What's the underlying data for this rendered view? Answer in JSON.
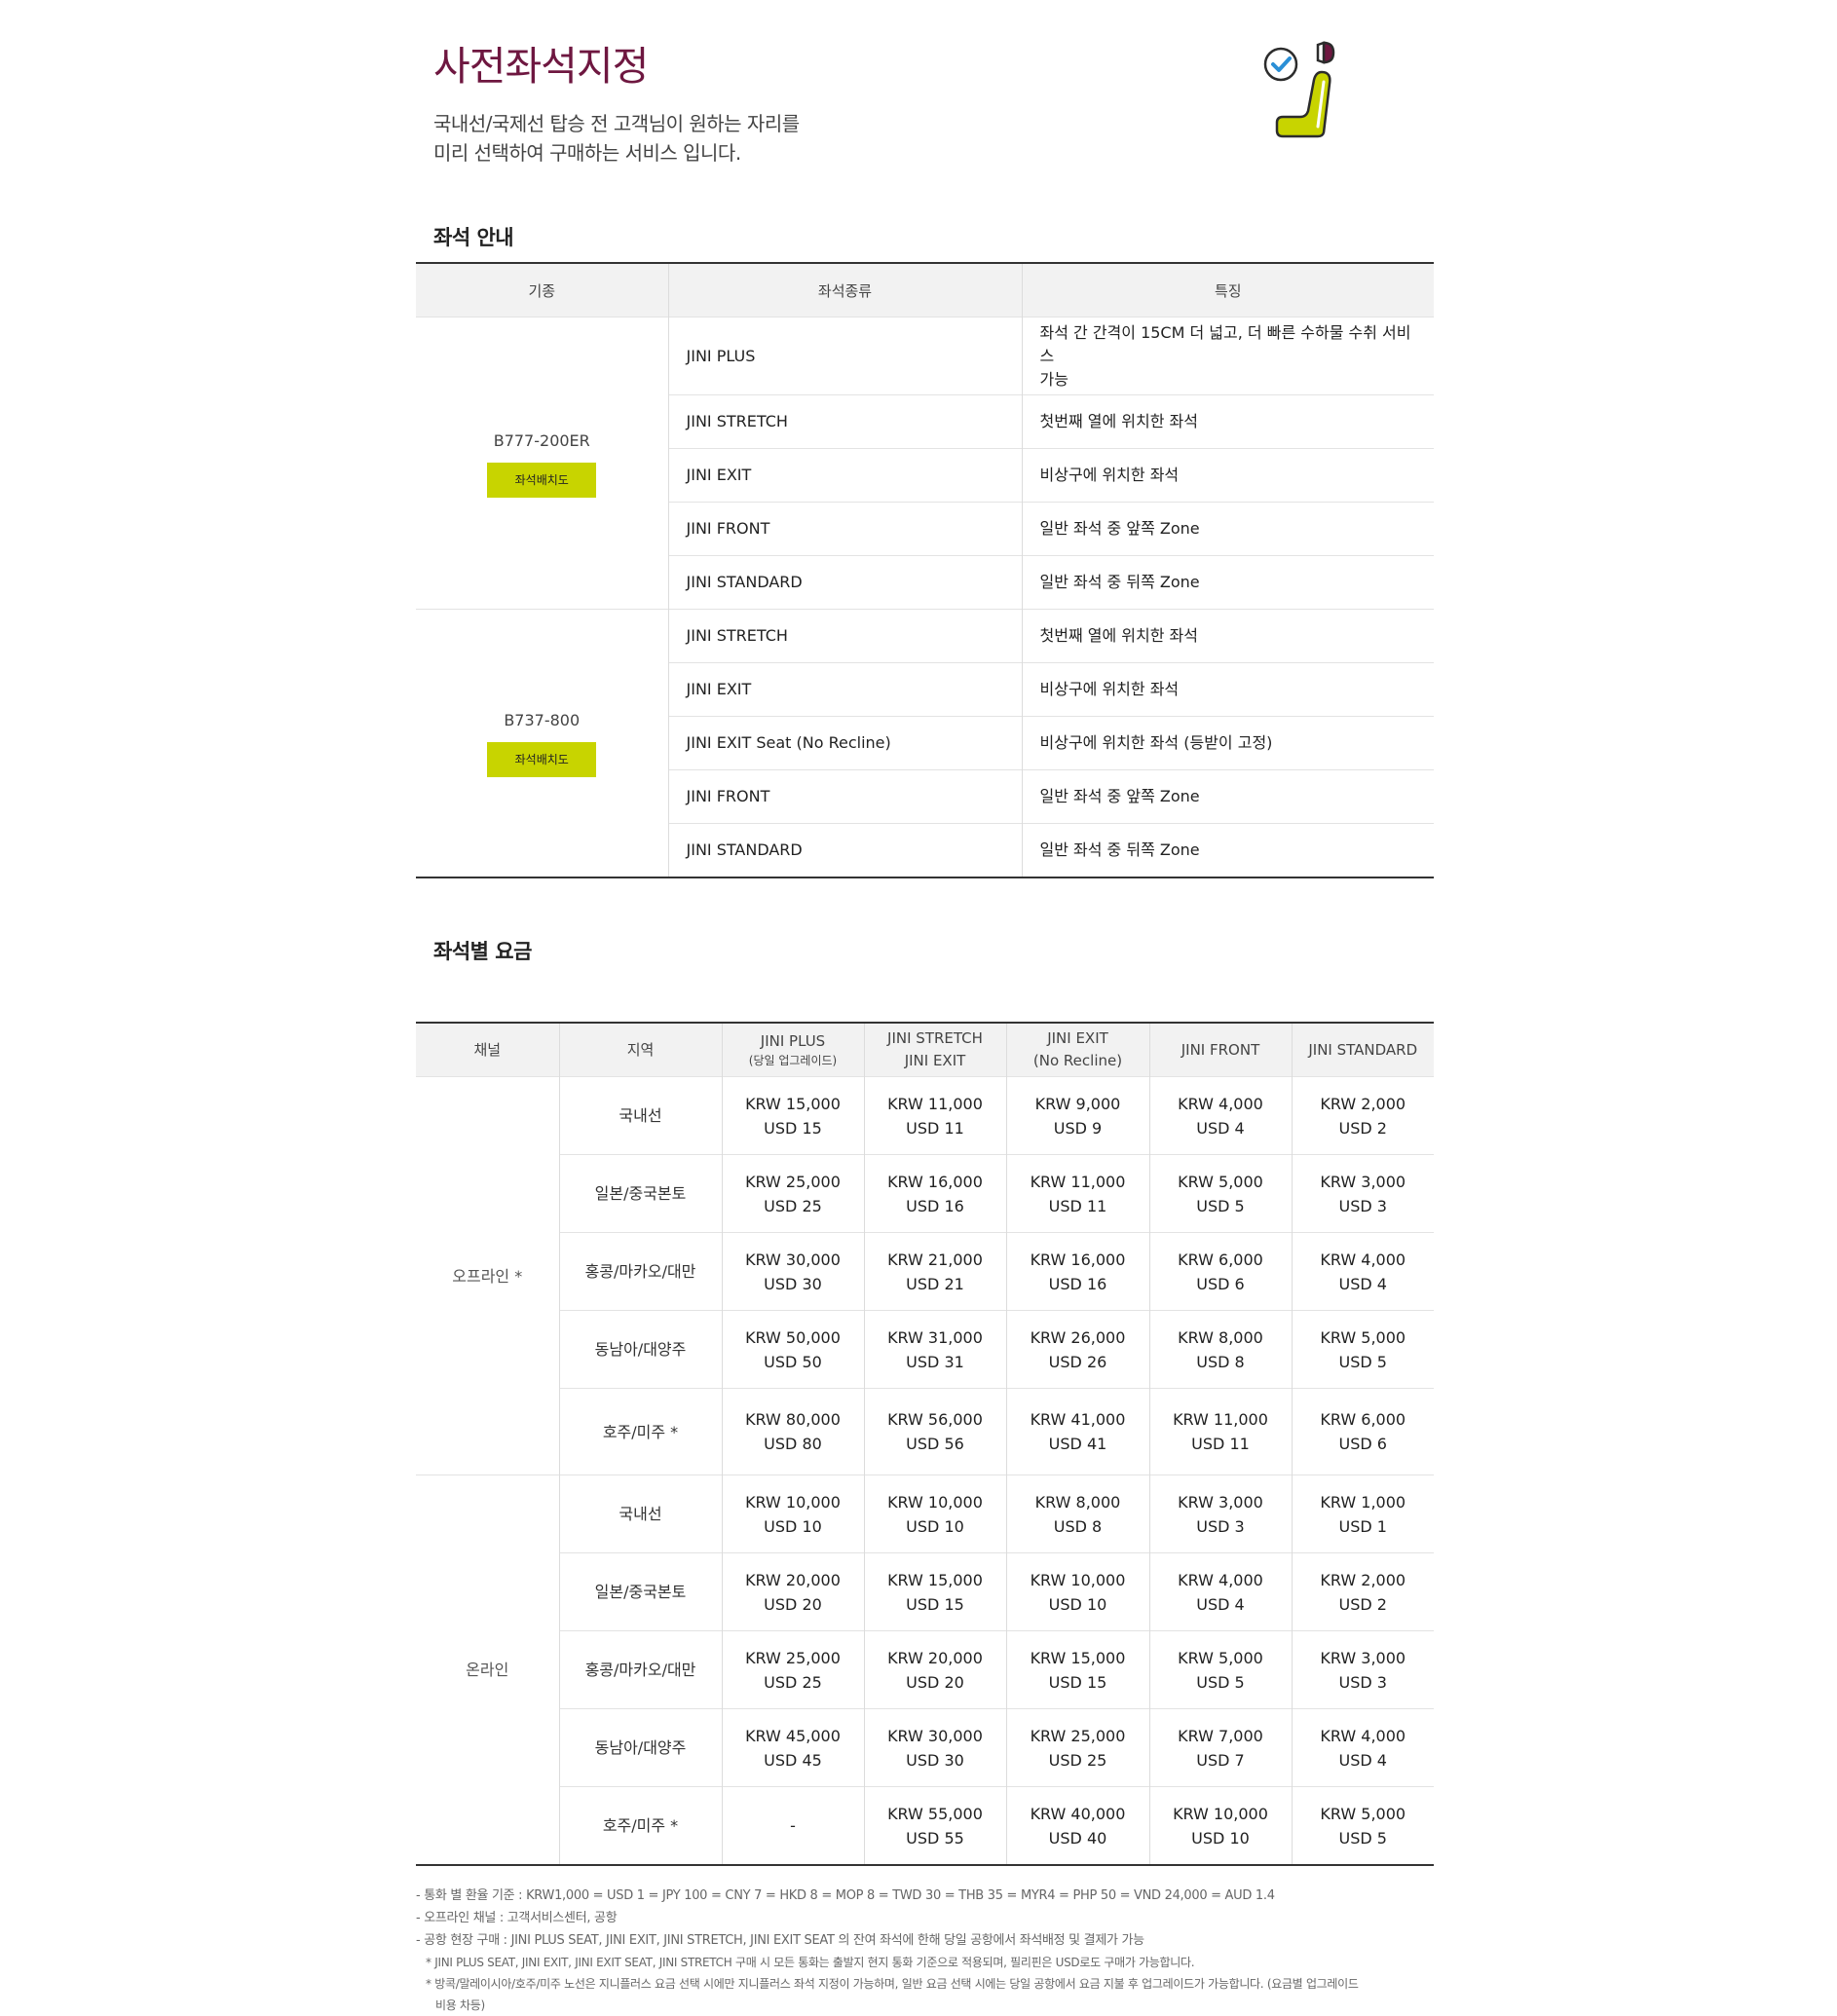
{
  "header": {
    "title": "사전좌석지정",
    "desc_line1": "국내선/국제선 탑승 전 고객님이 원하는 자리를",
    "desc_line2": "미리 선택하여 구매하는 서비스 입니다.",
    "icon": "seat-check-icon",
    "accent_color": "#6e1740",
    "brand_green": "#c8d400"
  },
  "seat_guide": {
    "heading": "좌석 안내",
    "columns": [
      "기종",
      "좌석종류",
      "특징"
    ],
    "map_button_label": "좌석배치도",
    "aircraft": [
      {
        "model": "B777-200ER",
        "rows": [
          {
            "type": "JINI PLUS",
            "feature_line1": "좌석 간 간격이 15CM 더 넓고, 더 빠른 수하물 수취 서비스",
            "feature_line2": "가능"
          },
          {
            "type": "JINI STRETCH",
            "feature_line1": "첫번째 열에 위치한 좌석"
          },
          {
            "type": "JINI EXIT",
            "feature_line1": "비상구에 위치한 좌석"
          },
          {
            "type": "JINI FRONT",
            "feature_line1": "일반 좌석 중 앞쪽 Zone"
          },
          {
            "type": "JINI STANDARD",
            "feature_line1": "일반 좌석 중 뒤쪽 Zone"
          }
        ]
      },
      {
        "model": "B737-800",
        "rows": [
          {
            "type": "JINI STRETCH",
            "feature_line1": "첫번째 열에 위치한 좌석"
          },
          {
            "type": "JINI EXIT",
            "feature_line1": "비상구에 위치한 좌석"
          },
          {
            "type": "JINI EXIT Seat (No Recline)",
            "feature_line1": "비상구에 위치한 좌석 (등받이 고정)"
          },
          {
            "type": "JINI FRONT",
            "feature_line1": "일반 좌석 중 앞쪽 Zone"
          },
          {
            "type": "JINI STANDARD",
            "feature_line1": "일반 좌석 중 뒤쪽 Zone"
          }
        ]
      }
    ]
  },
  "fares": {
    "heading": "좌석별 요금",
    "columns": {
      "channel": "채널",
      "region": "지역",
      "plus": "JINI PLUS",
      "plus_sub": "(당일 업그레이드)",
      "stretch_line1": "JINI STRETCH",
      "stretch_line2": "JINI EXIT",
      "exit_line1": "JINI EXIT",
      "exit_line2": "(No Recline)",
      "front": "JINI FRONT",
      "standard": "JINI STANDARD"
    },
    "channels": [
      {
        "name": "오프라인 *",
        "rows": [
          {
            "region": "국내선",
            "prices": [
              [
                "KRW 15,000",
                "USD 15"
              ],
              [
                "KRW 11,000",
                "USD 11"
              ],
              [
                "KRW 9,000",
                "USD 9"
              ],
              [
                "KRW 4,000",
                "USD 4"
              ],
              [
                "KRW 2,000",
                "USD 2"
              ]
            ]
          },
          {
            "region": "일본/중국본토",
            "prices": [
              [
                "KRW 25,000",
                "USD 25"
              ],
              [
                "KRW 16,000",
                "USD 16"
              ],
              [
                "KRW 11,000",
                "USD 11"
              ],
              [
                "KRW 5,000",
                "USD 5"
              ],
              [
                "KRW 3,000",
                "USD 3"
              ]
            ]
          },
          {
            "region": "홍콩/마카오/대만",
            "prices": [
              [
                "KRW 30,000",
                "USD 30"
              ],
              [
                "KRW 21,000",
                "USD 21"
              ],
              [
                "KRW 16,000",
                "USD 16"
              ],
              [
                "KRW 6,000",
                "USD 6"
              ],
              [
                "KRW 4,000",
                "USD 4"
              ]
            ]
          },
          {
            "region": "동남아/대양주",
            "prices": [
              [
                "KRW 50,000",
                "USD 50"
              ],
              [
                "KRW 31,000",
                "USD 31"
              ],
              [
                "KRW 26,000",
                "USD 26"
              ],
              [
                "KRW 8,000",
                "USD 8"
              ],
              [
                "KRW 5,000",
                "USD 5"
              ]
            ]
          },
          {
            "region": "호주/미주 *",
            "prices": [
              [
                "KRW 80,000",
                "USD 80"
              ],
              [
                "KRW 56,000",
                "USD 56"
              ],
              [
                "KRW 41,000",
                "USD 41"
              ],
              [
                "KRW 11,000",
                "USD 11"
              ],
              [
                "KRW 6,000",
                "USD 6"
              ]
            ]
          }
        ]
      },
      {
        "name": "온라인",
        "rows": [
          {
            "region": "국내선",
            "prices": [
              [
                "KRW 10,000",
                "USD 10"
              ],
              [
                "KRW 10,000",
                "USD 10"
              ],
              [
                "KRW 8,000",
                "USD 8"
              ],
              [
                "KRW 3,000",
                "USD 3"
              ],
              [
                "KRW 1,000",
                "USD 1"
              ]
            ]
          },
          {
            "region": "일본/중국본토",
            "prices": [
              [
                "KRW 20,000",
                "USD 20"
              ],
              [
                "KRW 15,000",
                "USD 15"
              ],
              [
                "KRW 10,000",
                "USD 10"
              ],
              [
                "KRW 4,000",
                "USD 4"
              ],
              [
                "KRW 2,000",
                "USD 2"
              ]
            ]
          },
          {
            "region": "홍콩/마카오/대만",
            "prices": [
              [
                "KRW 25,000",
                "USD 25"
              ],
              [
                "KRW 20,000",
                "USD 20"
              ],
              [
                "KRW 15,000",
                "USD 15"
              ],
              [
                "KRW 5,000",
                "USD 5"
              ],
              [
                "KRW 3,000",
                "USD 3"
              ]
            ]
          },
          {
            "region": "동남아/대양주",
            "prices": [
              [
                "KRW 45,000",
                "USD 45"
              ],
              [
                "KRW 30,000",
                "USD 30"
              ],
              [
                "KRW 25,000",
                "USD 25"
              ],
              [
                "KRW 7,000",
                "USD 7"
              ],
              [
                "KRW 4,000",
                "USD 4"
              ]
            ]
          },
          {
            "region": "호주/미주 *",
            "prices": [
              [
                "-",
                ""
              ],
              [
                "KRW 55,000",
                "USD 55"
              ],
              [
                "KRW 40,000",
                "USD 40"
              ],
              [
                "KRW 10,000",
                "USD 10"
              ],
              [
                "KRW 5,000",
                "USD 5"
              ]
            ]
          }
        ]
      }
    ]
  },
  "notes": {
    "n1": "- 통화 별 환율 기준 : KRW1,000 = USD 1 = JPY 100 = CNY 7 = HKD 8 = MOP 8 = TWD 30 = THB 35 = MYR4 = PHP 50 = VND 24,000 = AUD 1.4",
    "n2": "- 오프라인 채널 : 고객서비스센터, 공항",
    "n3": "- 공항 현장 구매 : JINI PLUS SEAT, JINI EXIT, JINI STRETCH, JINI EXIT SEAT 의 잔여 좌석에 한해 당일 공항에서 좌석배정 및 결제가 가능",
    "n4": "* JINI PLUS SEAT, JINI EXIT, JINI EXIT SEAT, JINI STRETCH 구매 시 모든 통화는 출발지 현지 통화 기준으로 적용되며, 필리핀은 USD로도 구매가 가능합니다.",
    "n5": "* 방콕/말레이시아/호주/미주 노선은 지니플러스 요금 선택 시에만 지니플러스 좌석 지정이 가능하며, 일반 요금 선택 시에는 당일 공항에서 요금 지불 후 업그레이드가 가능합니다. (요금별 업그레이드",
    "n6": "비용 차등)"
  }
}
